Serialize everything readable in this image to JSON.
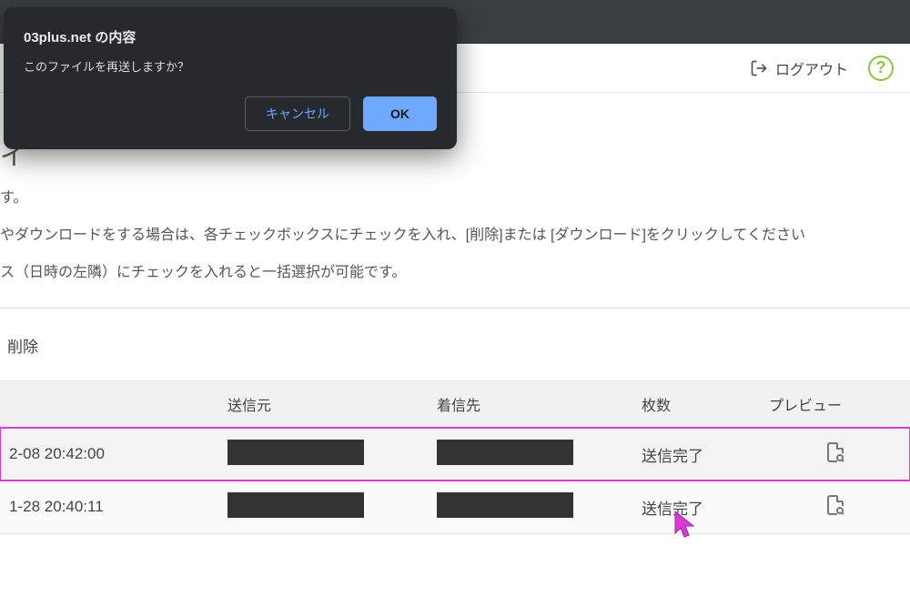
{
  "dialog": {
    "title": "03plus.net の内容",
    "message": "このファイルを再送しますか？",
    "cancel": "キャンセル",
    "ok": "OK"
  },
  "header": {
    "logout": "ログアウト",
    "help": "?"
  },
  "page": {
    "title_fragment": "イ",
    "desc1": "す。",
    "desc2": "やダウンロードをする場合は、各チェックボックスにチェックを入れ、[削除]または [ダウンロード]をクリックしてください",
    "desc3": "ス（日時の左隣）にチェックを入れると一括選択が可能です。",
    "delete_label": "削除"
  },
  "table": {
    "headers": {
      "datetime": "",
      "sender": "送信元",
      "recipient": "着信先",
      "count": "枚数",
      "preview": "プレビュー"
    },
    "rows": [
      {
        "datetime": "2-08 20:42:00",
        "status": "送信完了"
      },
      {
        "datetime": "1-28 20:40:11",
        "status": "送信完了"
      }
    ]
  }
}
